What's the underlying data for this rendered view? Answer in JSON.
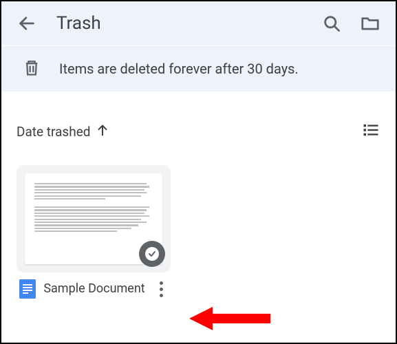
{
  "header": {
    "title": "Trash"
  },
  "banner": {
    "message": "Items are deleted forever after 30 days."
  },
  "sort": {
    "label": "Date trashed"
  },
  "documents": [
    {
      "title": "Sample Document"
    }
  ]
}
